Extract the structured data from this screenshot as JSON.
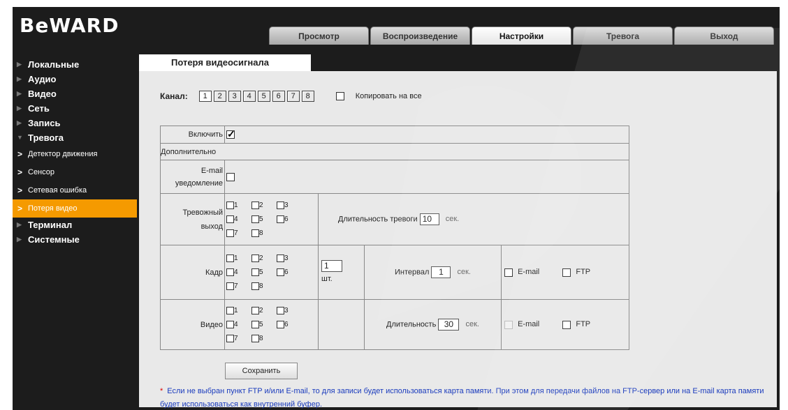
{
  "logo": "BeWARD",
  "tabs": [
    "Просмотр",
    "Воспроизведение",
    "Настройки",
    "Тревога",
    "Выход"
  ],
  "sidebar": {
    "items": [
      {
        "label": "Локальные"
      },
      {
        "label": "Аудио"
      },
      {
        "label": "Видео"
      },
      {
        "label": "Сеть"
      },
      {
        "label": "Запись"
      },
      {
        "label": "Тревога"
      }
    ],
    "subitems": [
      {
        "label": "Детектор движения"
      },
      {
        "label": "Сенсор"
      },
      {
        "label": "Сетевая ошибка"
      },
      {
        "label": "Потеря видео"
      }
    ],
    "items_after": [
      {
        "label": "Терминал"
      },
      {
        "label": "Системные"
      }
    ]
  },
  "content": {
    "tab_title": "Потеря видеосигнала",
    "channel_label": "Канал:",
    "channels": [
      "1",
      "2",
      "3",
      "4",
      "5",
      "6",
      "7",
      "8"
    ],
    "copy_all_label": "Копировать на все"
  },
  "table": {
    "enable_label": "Включить",
    "extra_label": "Дополнительно",
    "email_notify_label_1": "E-mail",
    "email_notify_label_2": "уведомление",
    "alarm_out_label_1": "Тревожный",
    "alarm_out_label_2": "выход",
    "alarm_duration_label": "Длительность тревоги",
    "alarm_duration_value": "10",
    "sec": "сек.",
    "frame_label": "Кадр",
    "frame_count_value": "1",
    "pcs": "шт.",
    "interval_label": "Интервал",
    "interval_value": "1",
    "email": "E-mail",
    "ftp": "FTP",
    "video_label": "Видео",
    "duration_label": "Длительность",
    "duration_value": "30",
    "cb_numbers": [
      "1",
      "2",
      "3",
      "4",
      "5",
      "6",
      "7",
      "8"
    ]
  },
  "save_label": "Сохранить",
  "note_star": "*",
  "note_text": "Если не выбран пункт FTP и/или E-mail, то для записи будет использоваться карта памяти. При этом для передачи файлов на FTP-сервер или на E-mail карта памяти будет использоваться как внутренний буфер."
}
